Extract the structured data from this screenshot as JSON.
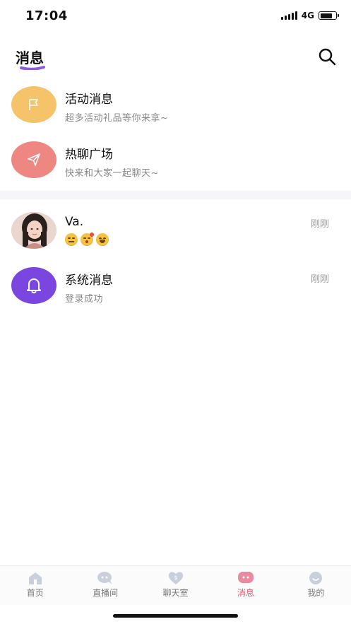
{
  "status": {
    "time": "17:04",
    "network": "4G",
    "battery_level": 0.8
  },
  "header": {
    "title": "消息",
    "search_icon": "search-icon",
    "underline_color": "#8c5ce0"
  },
  "items": [
    {
      "title": "活动消息",
      "subtitle": "超多活动礼品等你来拿~",
      "icon": "flag-icon",
      "avatar_color": "#f5c36a"
    },
    {
      "title": "热聊广场",
      "subtitle": "快来和大家一起聊天~",
      "icon": "send-icon",
      "avatar_color": "#ee8682"
    }
  ],
  "conversations": [
    {
      "name": "Va.",
      "time": "刚刚",
      "preview_emojis": [
        "expressionless-emoji",
        "kiss-emoji",
        "laughing-emoji"
      ]
    },
    {
      "name": "系统消息",
      "time": "刚刚",
      "preview": "登录成功",
      "icon": "bell-icon",
      "avatar_color": "#7b46e0"
    }
  ],
  "tabs": [
    {
      "label": "首页",
      "icon": "home-icon",
      "active": false
    },
    {
      "label": "直播间",
      "icon": "live-chat-icon",
      "active": false
    },
    {
      "label": "聊天室",
      "icon": "heart-chat-icon",
      "active": false
    },
    {
      "label": "消息",
      "icon": "message-icon",
      "active": true
    },
    {
      "label": "我的",
      "icon": "profile-icon",
      "active": false
    }
  ],
  "colors": {
    "accent": "#e2546b",
    "tab_inactive_icon": "#c9d0dc"
  }
}
